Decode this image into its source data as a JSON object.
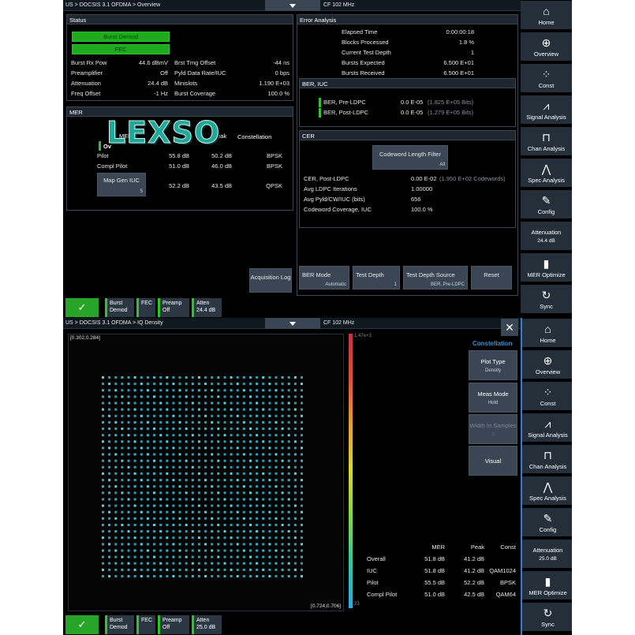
{
  "top": {
    "breadcrumb": "US > DOCSIS 3.1 OFDMA > Overview",
    "cf": "CF 102 MHz",
    "status": {
      "title": "Status",
      "burst_demod": "Burst Demod",
      "fec": "FEC",
      "left_rows": [
        {
          "label": "Burst Rx Pow",
          "value": "44.6 dBmV"
        },
        {
          "label": "Preamplifier",
          "value": "Off"
        },
        {
          "label": "Attenuation",
          "value": "24.4 dB"
        },
        {
          "label": "Freq Offset",
          "value": "-1 Hz"
        }
      ],
      "right_rows": [
        {
          "label": "Brst Tmg Offset",
          "value": "-44 ns"
        },
        {
          "label": "Pyld Data Rate/IUC",
          "value": "0 bps"
        },
        {
          "label": "Minislots",
          "value": "1.190 E+03"
        },
        {
          "label": "Burst Coverage",
          "value": "100.0 %"
        }
      ]
    },
    "mer": {
      "title": "MER",
      "header_partial_overall": "Ov",
      "header_partial_mer": "MER",
      "header_partial_peak": "Peak",
      "header_constellation": "Constellation",
      "watermark": "LEXSO",
      "rows": [
        {
          "label": "Pilot",
          "mer": "55.8 dB",
          "peak": "50.2 dB",
          "const": "BPSK"
        },
        {
          "label": "Compl Pilot",
          "mer": "51.0 dB",
          "peak": "46.0 dB",
          "const": "BPSK"
        }
      ],
      "map_gen_label": "Map Gen IUC",
      "map_gen_value": "5",
      "map_row": {
        "mer": "52.2 dB",
        "peak": "43.5 dB",
        "const": "QPSK"
      }
    },
    "acquisition_log": "Acquisition Log",
    "error": {
      "title": "Error Analysis",
      "rows": [
        {
          "label": "Elapsed Time",
          "value": "0:00:00:18"
        },
        {
          "label": "Blocks Processed",
          "value": "1.8 %"
        },
        {
          "label": "Current Test Depth",
          "value": "1"
        },
        {
          "label": "Bursts Expected",
          "value": "6.500 E+01"
        },
        {
          "label": "Bursts Received",
          "value": "6.500 E+01"
        }
      ],
      "ber": {
        "title": "BER, IUC",
        "rows": [
          {
            "label": "BER, Pre-LDPC",
            "value": "0.0 E-05",
            "bits": "(1.825 E+05 Bits)"
          },
          {
            "label": "BER, Post-LDPC",
            "value": "0.0 E-05",
            "bits": "(1.279 E+05 Bits)"
          }
        ]
      },
      "cer": {
        "title": "CER",
        "filter_label": "Codeword Length Filter",
        "filter_value": "All",
        "rows": [
          {
            "label": "CER, Post-LDPC",
            "value": "0.00 E-02",
            "extra": "(1.950 E+02 Codewords)"
          },
          {
            "label": "Avg LDPC Iterations",
            "value": "1.00000",
            "extra": ""
          },
          {
            "label": "Avg Pyld/CW/IUC (bits)",
            "value": "656",
            "extra": ""
          },
          {
            "label": "Codeword Coverage, IUC",
            "value": "100.0 %",
            "extra": ""
          }
        ]
      },
      "buttons": [
        {
          "label": "BER Mode",
          "sub": "Automatic"
        },
        {
          "label": "Test Depth",
          "sub": "1"
        },
        {
          "label": "Test Depth Source",
          "sub": "BER, Pre-LDPC"
        },
        {
          "label": "Reset",
          "sub": ""
        }
      ]
    },
    "statusbar": {
      "check": "✓",
      "items": [
        {
          "l1": "Burst",
          "l2": "Demod"
        },
        {
          "l1": "FEC",
          "l2": ""
        },
        {
          "l1": "Preamp",
          "l2": "Off"
        },
        {
          "l1": "Atten",
          "l2": "24.4 dB"
        }
      ]
    },
    "sidebar": [
      {
        "label": "Home",
        "icon": "home-icon",
        "glyph": "⌂",
        "value": ""
      },
      {
        "label": "Overview",
        "icon": "globe-icon",
        "glyph": "⊕",
        "value": ""
      },
      {
        "label": "Const",
        "icon": "constellation-icon",
        "glyph": "⁘",
        "value": ""
      },
      {
        "label": "Signal Analysis",
        "icon": "line-chart-icon",
        "glyph": "⩘",
        "value": ""
      },
      {
        "label": "Chan Analysis",
        "icon": "channel-icon",
        "glyph": "⊓",
        "value": ""
      },
      {
        "label": "Spec Analysis",
        "icon": "spectrum-icon",
        "glyph": "⋀",
        "value": ""
      },
      {
        "label": "Config",
        "icon": "wrench-icon",
        "glyph": "✎",
        "value": ""
      },
      {
        "label": "Attenuation",
        "icon": "",
        "glyph": "",
        "value": "24.4 dB"
      },
      {
        "label": "MER Optimize",
        "icon": "bar-chart-icon",
        "glyph": "▮",
        "value": ""
      },
      {
        "label": "Sync",
        "icon": "sync-icon",
        "glyph": "↻",
        "value": ""
      }
    ]
  },
  "bottom": {
    "breadcrumb": "US > DOCSIS 3.1 OFDMA > IQ Density",
    "cf": "CF 102 MHz",
    "close": "✕",
    "plot": {
      "corner_top_left": "[0.302,0.284]",
      "corner_bottom_right": "[0.724,0.706]",
      "scale_top": "1.47e+3",
      "scale_bottom": "23",
      "grid_cols": 32,
      "grid_rows": 32
    },
    "constellation_title": "Constellation",
    "buttons": [
      {
        "label": "Plot Type",
        "sub": "Density"
      },
      {
        "label": "Meas Mode",
        "sub": "Hold"
      },
      {
        "label": "Width In Samples",
        "sub": "1"
      },
      {
        "label": "Visual",
        "sub": ""
      }
    ],
    "table": {
      "headers": [
        "",
        "MER",
        "Peak",
        "Const"
      ],
      "rows": [
        [
          "Overall",
          "51.8 dB",
          "41.2 dB",
          ""
        ],
        [
          "IUC",
          "51.8 dB",
          "41.2 dB",
          "QAM1024"
        ],
        [
          "Pilot",
          "55.5 dB",
          "52.2 dB",
          "BPSK"
        ],
        [
          "Compl Pilot",
          "51.0 dB",
          "42.5 dB",
          "QAM64"
        ]
      ]
    },
    "statusbar": {
      "check": "✓",
      "items": [
        {
          "l1": "Burst",
          "l2": "Demod"
        },
        {
          "l1": "FEC",
          "l2": ""
        },
        {
          "l1": "Preamp",
          "l2": "Off"
        },
        {
          "l1": "Atten",
          "l2": "25.0 dB"
        }
      ]
    },
    "sidebar": [
      {
        "label": "Home",
        "icon": "home-icon",
        "glyph": "⌂",
        "value": ""
      },
      {
        "label": "Overview",
        "icon": "globe-icon",
        "glyph": "⊕",
        "value": ""
      },
      {
        "label": "Const",
        "icon": "constellation-icon",
        "glyph": "⁘",
        "value": ""
      },
      {
        "label": "Signal Analysis",
        "icon": "line-chart-icon",
        "glyph": "⩘",
        "value": ""
      },
      {
        "label": "Chan Analysis",
        "icon": "channel-icon",
        "glyph": "⊓",
        "value": ""
      },
      {
        "label": "Spec Analysis",
        "icon": "spectrum-icon",
        "glyph": "⋀",
        "value": ""
      },
      {
        "label": "Config",
        "icon": "wrench-icon",
        "glyph": "✎",
        "value": ""
      },
      {
        "label": "Attenuation",
        "icon": "",
        "glyph": "",
        "value": "25.0 dB"
      },
      {
        "label": "MER Optimize",
        "icon": "bar-chart-icon",
        "glyph": "▮",
        "value": ""
      },
      {
        "label": "Sync",
        "icon": "sync-icon",
        "glyph": "↻",
        "value": ""
      }
    ]
  }
}
